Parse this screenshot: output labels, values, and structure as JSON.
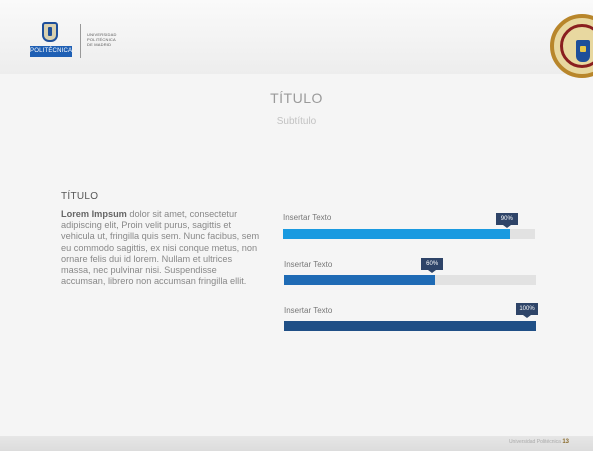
{
  "header": {
    "logo_label": "POLITÉCNICA",
    "university_lines": [
      "UNIVERSIDAD",
      "POLITÉCNICA",
      "DE MADRID"
    ]
  },
  "title": "TÍTULO",
  "subtitle": "Subtítulo",
  "left": {
    "heading": "TÍTULO",
    "lead": "Lorem Impsum",
    "body": " dolor sit amet, consectetur adipiscing elit, Proin velit purus, sagittis et vehicula ut, fringilla quis sem. Nunc facibus, sem eu commodo sagittis, ex nisi conque metus, non ornare felis dui id lorem. Nullam et ultrices massa, nec pulvinar nisi. Suspendisse accumsan, librero non accumsan fringilla ellit."
  },
  "bars": [
    {
      "label": "Insertar Texto",
      "value": 0.9,
      "tag": "90%",
      "color": "#1a9ae0"
    },
    {
      "label": "Insertar Texto",
      "value": 0.6,
      "tag": "60%",
      "color": "#1f6bb5"
    },
    {
      "label": "Insertar Texto",
      "value": 1.0,
      "tag": "100%",
      "color": "#1f4f86"
    }
  ],
  "footer": {
    "text": "Universidad Politécnica",
    "page": "13"
  },
  "colors": {
    "accent_light": "#1a9ae0",
    "accent_mid": "#1f6bb5",
    "accent_dark": "#1f4f86",
    "tag": "#2e4468"
  }
}
